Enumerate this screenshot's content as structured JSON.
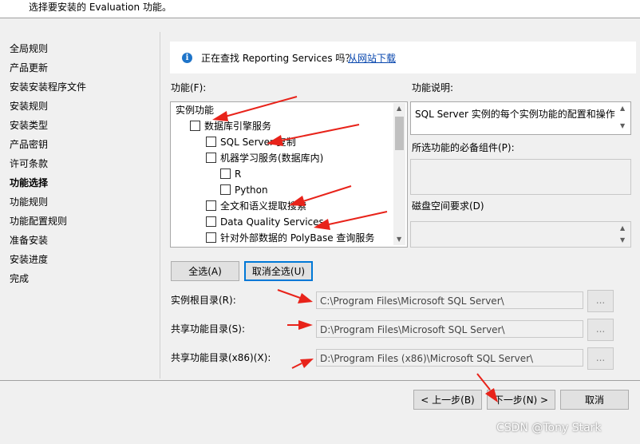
{
  "header": {
    "text": "选择要安装的 Evaluation 功能。"
  },
  "sidebar": {
    "items": [
      {
        "label": "全局规则",
        "active": false
      },
      {
        "label": "产品更新",
        "active": false
      },
      {
        "label": "安装安装程序文件",
        "active": false
      },
      {
        "label": "安装规则",
        "active": false
      },
      {
        "label": "安装类型",
        "active": false
      },
      {
        "label": "产品密钥",
        "active": false
      },
      {
        "label": "许可条款",
        "active": false
      },
      {
        "label": "功能选择",
        "active": true
      },
      {
        "label": "功能规则",
        "active": false
      },
      {
        "label": "功能配置规则",
        "active": false
      },
      {
        "label": "准备安装",
        "active": false
      },
      {
        "label": "安装进度",
        "active": false
      },
      {
        "label": "完成",
        "active": false
      }
    ]
  },
  "info": {
    "text": "正在查找 Reporting Services 吗？",
    "link": "从网站下载",
    "icon": "info-icon"
  },
  "features": {
    "label": "功能(F):",
    "items": [
      {
        "label": "实例功能",
        "checkbox": false,
        "checked": false
      },
      {
        "label": "数据库引擎服务",
        "checkbox": true,
        "checked": false
      },
      {
        "label": "SQL Server 复制",
        "checkbox": true,
        "checked": false
      },
      {
        "label": "机器学习服务(数据库内)",
        "checkbox": true,
        "checked": false
      },
      {
        "label": "R",
        "checkbox": true,
        "checked": false
      },
      {
        "label": "Python",
        "checkbox": true,
        "checked": false
      },
      {
        "label": "全文和语义提取搜索",
        "checkbox": true,
        "checked": false
      },
      {
        "label": "Data Quality Services",
        "checkbox": true,
        "checked": false
      },
      {
        "label": "针对外部数据的 PolyBase 查询服务",
        "checkbox": true,
        "checked": false
      }
    ]
  },
  "description": {
    "label": "功能说明:",
    "text": "SQL Server 实例的每个实例功能的配置和操作",
    "prereq_label": "所选功能的必备组件(P):",
    "disk_label": "磁盘空间要求(D)"
  },
  "buttons": {
    "select_all": "全选(A)",
    "unselect_all": "取消全选(U)"
  },
  "paths": {
    "instance_root_label": "实例根目录(R):",
    "instance_root_value": "C:\\Program Files\\Microsoft SQL Server\\",
    "shared_label": "共享功能目录(S):",
    "shared_value": "D:\\Program Files\\Microsoft SQL Server\\",
    "shared_x86_label": "共享功能目录(x86)(X):",
    "shared_x86_value": "D:\\Program Files (x86)\\Microsoft SQL Server\\",
    "browse": "..."
  },
  "footer": {
    "back": "< 上一步(B)",
    "next": "下一步(N) >",
    "cancel": "取消"
  },
  "watermark": "CSDN @Tony Stark",
  "colors": {
    "link": "#0645ad",
    "info_icon": "#1e74c9",
    "arrow": "#e8231a",
    "focus": "#0078d7"
  }
}
